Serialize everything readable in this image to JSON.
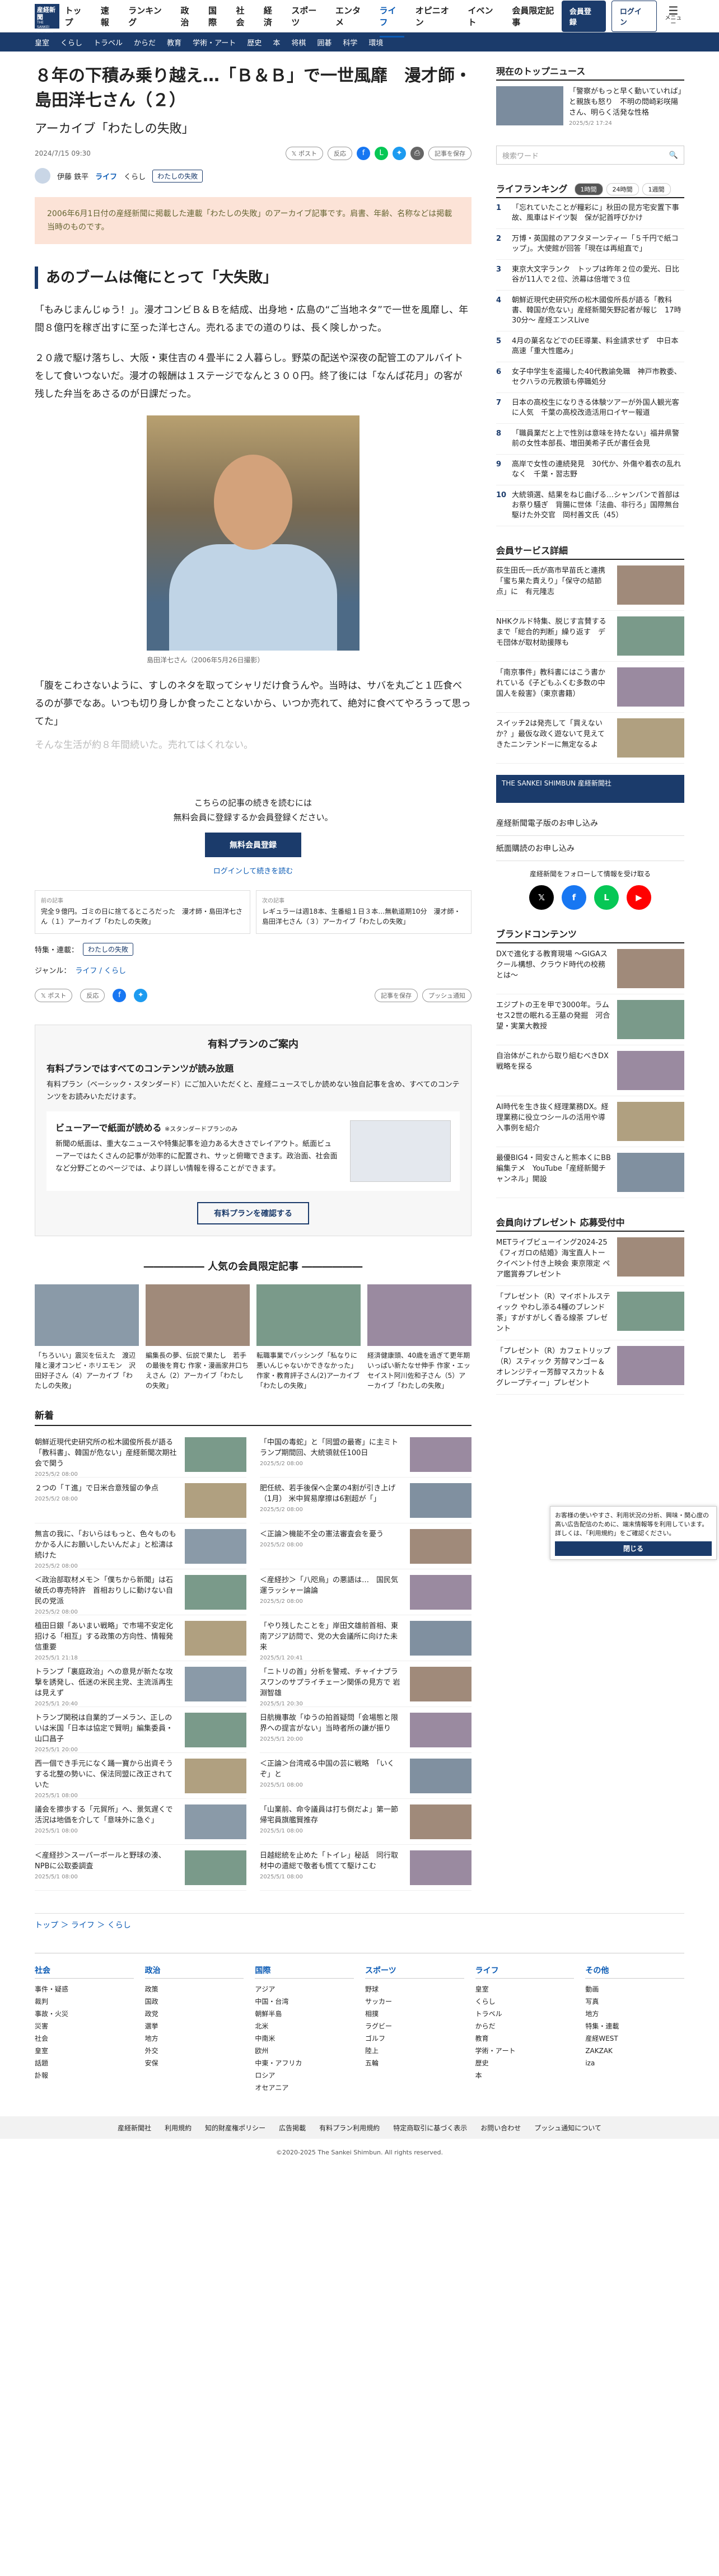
{
  "header": {
    "logo_text": "産経新聞",
    "logo_sub": "THE SANKEI SHIMBUN",
    "nav": [
      "トップ",
      "速報",
      "ランキング",
      "政治",
      "国際",
      "社会",
      "経済",
      "スポーツ",
      "エンタメ",
      "ライフ",
      "オピニオン",
      "イベント",
      "会員限定記事"
    ],
    "active_nav": "ライフ",
    "member_btn": "会員登録",
    "login_btn": "ログイン",
    "menu_label": "メニュー"
  },
  "subnav": [
    "皇室",
    "くらし",
    "トラベル",
    "からだ",
    "教育",
    "学術・アート",
    "歴史",
    "本",
    "将棋",
    "囲碁",
    "科学",
    "環境"
  ],
  "article": {
    "title": "８年の下積み乗り越え…「Ｂ＆Ｂ」で一世風靡　漫才師・島田洋七さん（２）",
    "subtitle": "アーカイブ「わたしの失敗」",
    "date": "2024/7/15 09:30",
    "post_btn": "ポスト",
    "reaction_btn": "反応",
    "save_btn": "記事を保存",
    "author": "伊藤 鉄平",
    "category": "ライフ",
    "subcategory": "くらし",
    "tag": "わたしの失敗",
    "notice": "2006年6月1日付の産経新聞に掲載した連載「わたしの失敗」のアーカイブ記事です。肩書、年齢、名称などは掲載当時のものです。",
    "heading": "あのブームは俺にとって「大失敗」",
    "p1": "「もみじまんじゅう！」。漫才コンビＢ＆Ｂを結成、出身地・広島の“ご当地ネタ”で一世を風靡し、年間８億円を稼ぎ出すに至った洋七さん。売れるまでの道のりは、長く険しかった。",
    "p2": "２０歳で駆け落ちし、大阪・東住吉の４畳半に２人暮らし。野菜の配送や深夜の配管工のアルバイトをして食いつないだ。漫才の報酬は１ステージでなんと３００円。終了後には「なんば花月」の客が残した弁当をあさるのが日課だった。",
    "photo_caption": "島田洋七さん（2006年5月26日撮影）",
    "p3": "「腹をこわさないように、すしのネタを取ってシャリだけ食うんや。当時は、サバを丸ごと１匹食べるのが夢でなあ。いつも切り身しか食ったことないから、いつか売れて、絶対に食べてやろうって思ってた」",
    "p4": "そんな生活が約８年間続いた。売れてはくれない。",
    "paywall_text1": "こちらの記事の続きを読むには",
    "paywall_text2": "無料会員に登録するか会員登録ください。",
    "register_btn": "無料会員登録",
    "login_link": "ログインして続きを読む",
    "prev_label": "前の記事",
    "prev_title": "完全９億円。ゴミの日に捨てるところだった　漫才師・島田洋七さん（１）アーカイブ「わたしの失敗」",
    "next_label": "次の記事",
    "next_title": "レギュラーは週18本、生番組１日３本…無軌道期10分　漫才師・島田洋七さん（３）アーカイブ「わたしの失敗」",
    "tag_label": "特集・連載：",
    "genre_label": "ジャンル：",
    "genre_value": "ライフ / くらし",
    "push_label": "プッシュ通知"
  },
  "plan": {
    "title": "有料プランのご案内",
    "h1": "有料プランではすべてのコンテンツが読み放題",
    "p1": "有料プラン（ベーシック・スタンダード）にご加入いただくと、産経ニュースでしか読めない独自記事を含め、すべてのコンテンツをお読みいただけます。",
    "h2": "ビューアーで紙面が読める",
    "h2_note": "※スタンダードプランのみ",
    "p2": "新聞の紙面は、重大なニュースや特集記事を迫力ある大きさでレイアウト。紙面ビューアーではたくさんの記事が効率的に配置され、サッと俯瞰できます。政治面、社会面など分野ごとのページでは、より詳しい情報を得ることができます。",
    "btn": "有料プランを確認する"
  },
  "popular": {
    "title": "人気の会員限定記事",
    "items": [
      "「ちろいい」震災を伝えた　渡辺隆と漫才コンビ・ホリエモン　沢田好子さん（4）アーカイブ「わたしの失敗」",
      "編集長の夢、伝説で果たし　若手の最後を育む 作家・漫画家井口ちえさん（2）アーカイブ「わたしの失敗」",
      "転職事業でバッシング「私なりに悪いんじゃないかできなかった」作家・教育評子さん(2)アーカイブ「わたしの失敗」",
      "経済健康頭、40歳を過ぎて更年期いっぱい新たなせ伸手 作家・エッセイスト阿川佐和子さん（5）アーカイブ「わたしの失敗」"
    ]
  },
  "news": {
    "title": "新着",
    "items": [
      {
        "t": "朝鮮近現代史研究所の松木國俊所長が語る「教科書」、韓国が危ない」産経新聞次期社会で関う",
        "d": "2025/5/2 08:00"
      },
      {
        "t": "「中国の毒蛇」と「同盟の最寄」に主ミトランプ期間回、大統領就任100日",
        "d": "2025/5/2 08:00"
      },
      {
        "t": "２つの「Ｔ進」で日米合意残留の争点",
        "d": "2025/5/2 08:00"
      },
      {
        "t": "肥任統、若手後保へ企業の4割が引き上げ（1月） 米中貿易摩擦は6割超が「」",
        "d": "2025/5/2 08:00"
      },
      {
        "t": "無言の我に、「おいらはもっと、色々ものもかかる人にお願いしたいんだよ」と松濤は続けた",
        "d": "2025/5/2 08:00"
      },
      {
        "t": "＜正論＞機能不全の憲法審査会を憂う",
        "d": "2025/5/2 08:00"
      },
      {
        "t": "＜政治部取材メモ＞「僕ちから新聞」は石破氏の専売特許　首相おりしに動けない自民の党派",
        "d": "2025/5/2 08:00"
      },
      {
        "t": "＜産経抄＞「八咫烏」の悪語は…　国民気運ラッシャー論論",
        "d": "2025/5/2 08:00"
      },
      {
        "t": "植田日銀「あいまい戦略」で市場不安定化招ける「相互」する政策の方向性、情報発信重要",
        "d": "2025/5/1 21:18"
      },
      {
        "t": "「やり残したことを」岸田文雄前首相、東南アジア訪問で、党の大会議所に向けた未来",
        "d": "2025/5/1 20:41"
      },
      {
        "t": "トランプ「裏庭政治」への意見が新たな攻撃を誘発し、低迷の米民主党、主流派再生は見えず",
        "d": "2025/5/1 20:40"
      },
      {
        "t": "「ニトリの首」分析を警戒、チャイナプラスワンのサプライチェーン関係の見方で 岩淵智雄",
        "d": "2025/5/1 20:30"
      },
      {
        "t": "トランプ関税は自業的ブーメラン、正しのいは米国「日本は協定で賢明」編集委員・山口昌子",
        "d": "2025/5/1 20:00"
      },
      {
        "t": "日航機事故「ゆうの拍首疑問「会場態と限界への提言がない」当時者所の謙が振り",
        "d": "2025/5/1 20:00"
      },
      {
        "t": "西一個でき手元になく踊一寶から出資そうする北整の勢いに、保法同盟に改正されていた",
        "d": "2025/5/1 08:00"
      },
      {
        "t": "＜正論＞台湾戒る中国の芸に戦略　「いくぞ」と",
        "d": "2025/5/1 08:00"
      },
      {
        "t": "議会を擦歩する「元貿所」へ、景気遅くで活況は地価を介して「意味外に急ぐ」",
        "d": "2025/5/1 08:00"
      },
      {
        "t": "「山業前、命令議員は打ち倒だよ」第一節帰宅員旗艦賢推存",
        "d": "2025/5/1 08:00"
      },
      {
        "t": "＜産経抄＞スーパーボールと野球の湊、NPBに公取委調査",
        "d": "2025/5/1 08:00"
      },
      {
        "t": "日越総統を止めた「トイレ」秘話　同行取材中の遣総で敬者も慌てて駆けこむ",
        "d": "2025/5/1 08:00"
      }
    ]
  },
  "side": {
    "top_title": "現在のトップニュース",
    "top_news": "「警察がもっと早く動いていれば」と親族も怒り　不明の問崎彩咲陽さん、明らく活発な性格",
    "top_date": "2025/5/2 17:24",
    "search_placeholder": "検索ワード",
    "rank_title": "ライフランキング",
    "rank_tabs": [
      "1時間",
      "24時間",
      "1週間"
    ],
    "rank_active": "1時間",
    "rank": [
      "「忘れていたことが糧彩に」秋田の昆方宅安置下事故、風車はドイツ製　保が記首呼びかけ",
      "万博・英国館のアフタヌーンティー「５千円で紙コップ」。大使館が回答「現在は再組直で」",
      "東京大文字ランク　トップは昨年２位の愛光、日比谷が11人で２位、渋幕は倍増で３位",
      "朝鮮近現代史研究所の松木國俊所長が語る「教科書、韓国が危ない」産経新聞矢野記者が報じ　17時30分〜 産経エンスLive",
      "4月の菓名などでのEE導業、料金請求せず　中日本高速「重大性鑑み」",
      "女子中学生を盗撮した40代教諭免職　神戸市教委、セクハラの元教頭も停職処分",
      "日本の高校生になりきる体験ツアーが外国人観光客に人気　千葉の高校改造活用ロイヤー報道",
      "「職員業だと上で性別は意味を持たない」福井県警前の女性本部長、増田美希子氏が書任会見",
      "高岸で女性の連続発見　30代か、外傷や着衣の乱れなく　千葉・習志野",
      "大統領選、結果をねじ曲げる…シャンパンで首部はお祭り騒ぎ　背腸に世体「法曲、非行ろ」国際無台駆けた外交官　岡村善文氏（45）"
    ],
    "svc_title": "会員サービス詳細",
    "svc": [
      "荻生田氏一氏が高市早苗氏と連携「蜜ち果た責えり」「保守の結節点」に　有元隆志",
      "NHKクルド特集、脱じす言賛するまで「総合的判断」繰り返す　デモ団体が取材助援隊も",
      "「南京事件」教科書にはこう書かれている《子どもふくむ多数の中国人を殺害》（東京書籍）",
      "スイッチ2は発売して「買えないか？」最仮な政く遊ないて見えてきたニンテンドーに無定なるよ"
    ],
    "sankei_banner": "THE SANKEI SHIMBUN 産経新聞社",
    "links": [
      "産経新聞電子版のお申し込み",
      "紙面購読のお申し込み"
    ],
    "follow_text": "産経新聞をフォローして情報を受け取る",
    "brand_title": "ブランドコンテンツ",
    "brand": [
      "DXで進化する教育現場 ～GIGAスクール構想、クラウド時代の校務とは～",
      "エジプトの王を甲で3000年。ラムセス2世の眠れる王墓の発掘　河合望・実業大教授",
      "自治体がこれから取り組むべきDX戦略を探る",
      "AI時代を生き抜く経理業務DX。経理業務に役立つシールの活用や導入事例を紹介",
      "最優BIG4・岡安さんと熊本くにBB編集テメ　YouTube「産経新聞チャンネル」開設"
    ],
    "present_title": "会員向けプレゼント 応募受付中",
    "present": [
      "METライブビューイング2024-25《フィガロの結婚》海宝直人トークイベント付き上映会 東京限定 ペア鑑賞券プレゼント",
      "「プレゼント（R）マイボトルスティック やわし添る4種のブレンド茶」すがすがしく香る線茶 プレゼント",
      "「プレゼント（R）カフェトリップ（R）スティック 芳醇マンゴー＆オレンジティー芳醇マスカット＆グレープティー」プレゼント"
    ]
  },
  "cookie": {
    "text": "お客様の使いやすさ、利用状況の分析、興味・関心度の高い広告配信のために、端末情報等を利用しています。詳しくは、「利用規約」をご確認ください。",
    "ok": "閉じる"
  },
  "crumb": "トップ ＞ ライフ ＞ くらし",
  "footer": [
    {
      "h": "社会",
      "items": [
        "事件・疑惑",
        "裁判",
        "事故・火災",
        "災害",
        "社会",
        "皇室",
        "話題",
        "訃報"
      ]
    },
    {
      "h": "政治",
      "items": [
        "政策",
        "国政",
        "政党",
        "選挙",
        "地方",
        "外交",
        "安保"
      ]
    },
    {
      "h": "国際",
      "items": [
        "アジア",
        "中国・台湾",
        "朝鮮半島",
        "北米",
        "中南米",
        "欧州",
        "中東・アフリカ",
        "ロシア",
        "オセアニア"
      ]
    },
    {
      "h": "スポーツ",
      "items": [
        "野球",
        "サッカー",
        "相撲",
        "ラグビー",
        "ゴルフ",
        "陸上",
        "五輪"
      ]
    },
    {
      "h": "ライフ",
      "items": [
        "皇室",
        "くらし",
        "トラベル",
        "からだ",
        "教育",
        "学術・アート",
        "歴史",
        "本"
      ]
    },
    {
      "h": "その他",
      "items": [
        "動画",
        "写真",
        "地方",
        "特集・連載",
        "産経WEST",
        "ZAKZAK",
        "iza"
      ]
    }
  ],
  "footer_links": [
    "産経新聞社",
    "利用規約",
    "知的財産権ポリシー",
    "広告掲載",
    "有料プラン利用規約",
    "特定商取引に基づく表示",
    "お問い合わせ",
    "プッシュ通知について"
  ],
  "copyright": "©2020-2025 The Sankei Shimbun. All rights reserved."
}
